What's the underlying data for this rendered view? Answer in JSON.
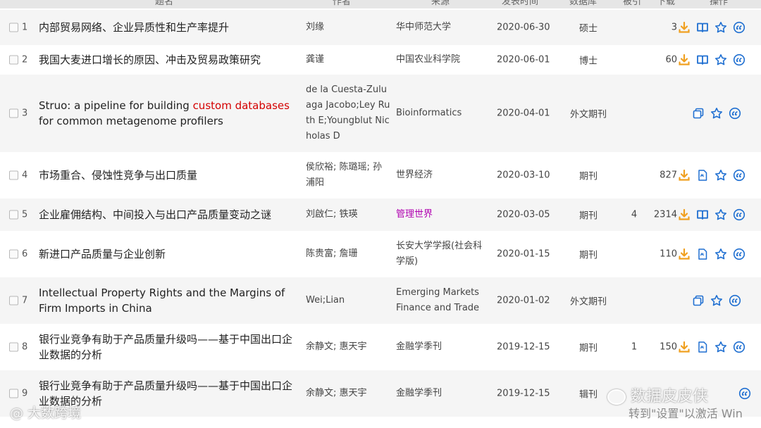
{
  "colors": {
    "download": "#f0a020",
    "ops_blue": "#1f6fd1",
    "highlight_red": "#d40000",
    "source_purple": "#b000b0",
    "row_alt": "#f5f5f5"
  },
  "header": {
    "title": "题名",
    "author": "作者",
    "source": "来源",
    "date": "发表时间",
    "database": "数据库",
    "cited": "被引",
    "downloads": "下载",
    "ops": "操作"
  },
  "rows": [
    {
      "num": "1",
      "title": "内部贸易网络、企业异质性和生产率提升",
      "author": "刘缘",
      "source": "华中师范大学",
      "date": "2020-06-30",
      "database": "硕士",
      "cited": "",
      "downloads": "3",
      "icons": [
        "download-icon",
        "read-icon",
        "favorite-icon",
        "cite-icon"
      ]
    },
    {
      "num": "2",
      "title": "我国大麦进口增长的原因、冲击及贸易政策研究",
      "author": "龚谨",
      "source": "中国农业科学院",
      "date": "2020-06-01",
      "database": "博士",
      "cited": "",
      "downloads": "60",
      "icons": [
        "download-icon",
        "read-icon",
        "favorite-icon",
        "cite-icon"
      ]
    },
    {
      "num": "3",
      "title_pre": "Struo: a pipeline for building ",
      "title_hl": "custom databases",
      "title_post": " for common metagenome profilers",
      "author": "de la Cuesta-Zuluaga Jacobo;Ley Ruth E;Youngblut Nicholas D",
      "source": "Bioinformatics",
      "date": "2020-04-01",
      "database": "外文期刊",
      "cited": "",
      "downloads": "",
      "icons": [
        "copy-icon",
        "favorite-icon",
        "cite-icon"
      ]
    },
    {
      "num": "4",
      "title": "市场重合、侵蚀性竞争与出口质量",
      "author": "侯欣裕; 陈璐瑶; 孙浦阳",
      "source": "世界经济",
      "date": "2020-03-10",
      "database": "期刊",
      "cited": "",
      "downloads": "827",
      "icons": [
        "download-icon",
        "html-icon",
        "favorite-icon",
        "cite-icon"
      ]
    },
    {
      "num": "5",
      "title": "企业雇佣结构、中间投入与出口产品质量变动之谜",
      "author": "刘啟仁; 铁瑛",
      "source": "管理世界",
      "date": "2020-03-05",
      "database": "期刊",
      "cited": "4",
      "downloads": "2314",
      "icons": [
        "download-icon",
        "read-icon",
        "favorite-icon",
        "cite-icon"
      ]
    },
    {
      "num": "6",
      "title": "新进口产品质量与企业创新",
      "author": "陈贵富; 詹珊",
      "source": "长安大学学报(社会科学版)",
      "date": "2020-01-15",
      "database": "期刊",
      "cited": "",
      "downloads": "110",
      "icons": [
        "download-icon",
        "html-icon",
        "favorite-icon",
        "cite-icon"
      ]
    },
    {
      "num": "7",
      "title": "Intellectual Property Rights and the Margins of Firm Imports in China",
      "author": "Wei;Lian",
      "source": "Emerging Markets Finance and Trade",
      "date": "2020-01-02",
      "database": "外文期刊",
      "cited": "",
      "downloads": "",
      "icons": [
        "copy-icon",
        "favorite-icon",
        "cite-icon"
      ]
    },
    {
      "num": "8",
      "title": "银行业竞争有助于产品质量升级吗——基于中国出口企业数据的分析",
      "author": "余静文; 惠天宇",
      "source": "金融学季刊",
      "date": "2019-12-15",
      "database": "期刊",
      "cited": "1",
      "downloads": "150",
      "icons": [
        "download-icon",
        "html-icon",
        "favorite-icon",
        "cite-icon"
      ]
    },
    {
      "num": "9",
      "title": "银行业竞争有助于产品质量升级吗——基于中国出口企业数据的分析",
      "author": "余静文; 惠天宇",
      "source": "金融学季刊",
      "date": "2019-12-15",
      "database": "辑刊",
      "cited": "",
      "downloads": "",
      "icons": [
        "cite-icon"
      ]
    }
  ],
  "watermark": {
    "left": "大数跨境",
    "right": "数据皮皮侠",
    "win": "转到\"设置\"以激活 Win"
  }
}
